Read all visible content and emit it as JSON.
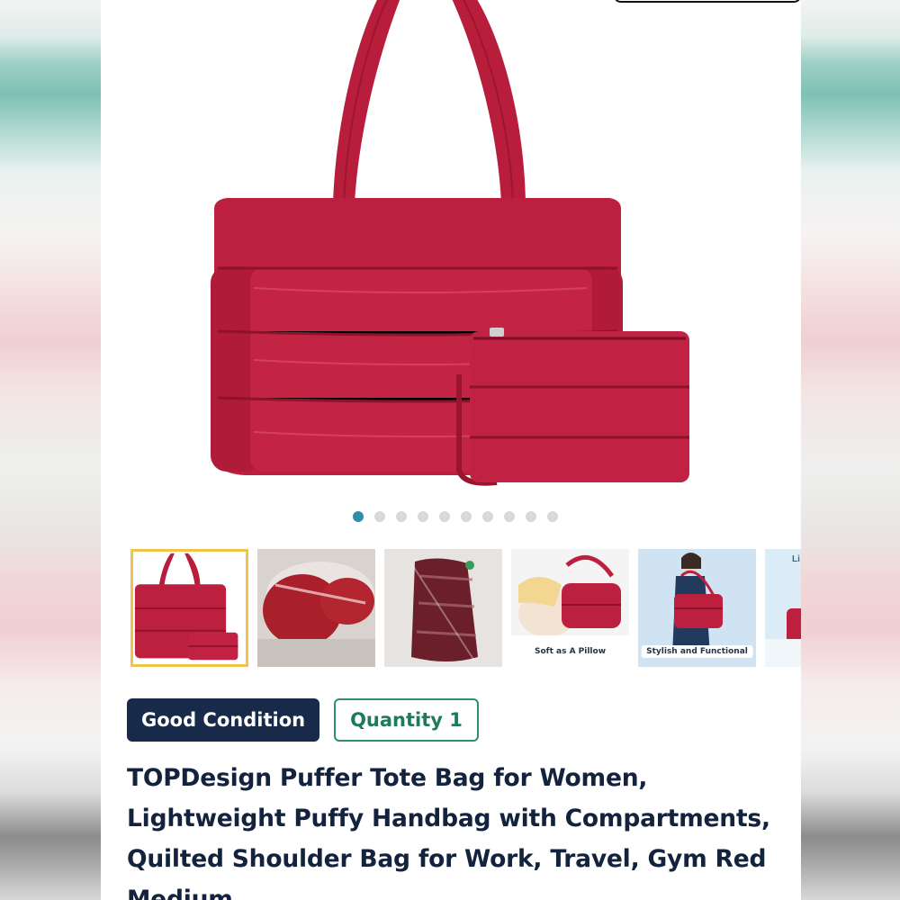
{
  "gallery": {
    "image_count": 10,
    "active_index": 0,
    "thumbnails": [
      {
        "kind": "product-front",
        "caption": ""
      },
      {
        "kind": "packaged-folded",
        "caption": ""
      },
      {
        "kind": "packaged-bag",
        "caption": ""
      },
      {
        "kind": "pillow",
        "caption": "Soft as A Pillow"
      },
      {
        "kind": "model",
        "caption": "Stylish and Functional"
      },
      {
        "kind": "partial",
        "caption": "Li"
      }
    ]
  },
  "badges": {
    "condition": "Good Condition",
    "quantity": "Quantity 1"
  },
  "product": {
    "title": "TOPDesign Puffer Tote Bag for Women, Lightweight Puffy Handbag with Compartments, Quilted Shoulder Bag for Work, Travel, Gym Red Medium"
  },
  "colors": {
    "bag_red": "#bd1f3f",
    "active_dot": "#2f8fa6",
    "condition_badge": "#172a4a",
    "quantity_badge": "#2f8f6c",
    "title_text": "#14233d"
  }
}
